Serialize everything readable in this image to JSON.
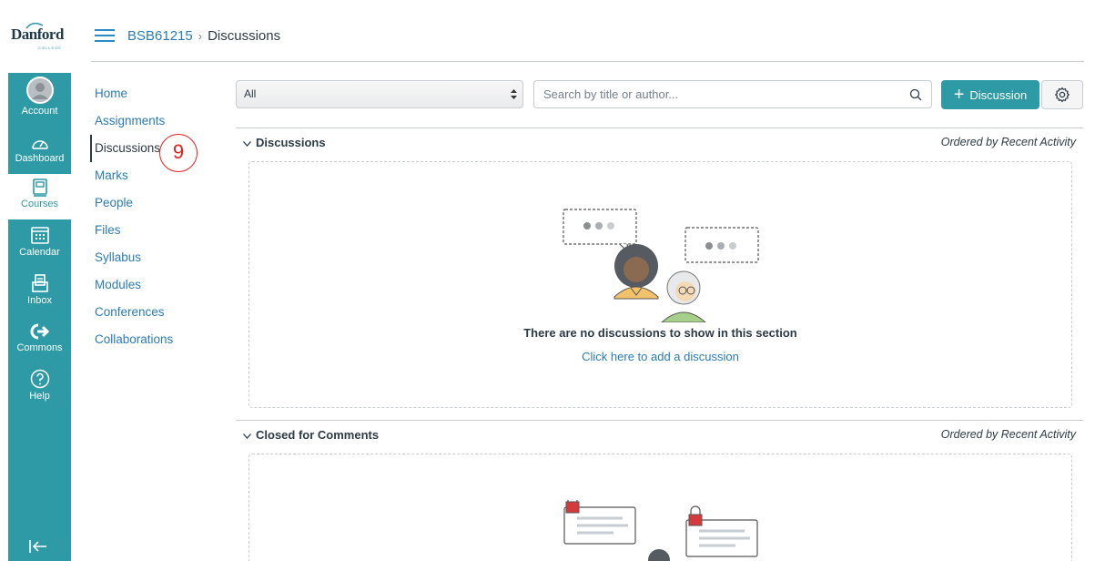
{
  "brand": {
    "name": "Danford",
    "sub": "COLLEGE"
  },
  "global_nav": [
    {
      "label": "Account",
      "icon": "avatar-icon"
    },
    {
      "label": "Dashboard",
      "icon": "dashboard-icon"
    },
    {
      "label": "Courses",
      "icon": "courses-icon"
    },
    {
      "label": "Calendar",
      "icon": "calendar-icon"
    },
    {
      "label": "Inbox",
      "icon": "inbox-icon"
    },
    {
      "label": "Commons",
      "icon": "commons-icon"
    },
    {
      "label": "Help",
      "icon": "help-icon"
    }
  ],
  "breadcrumb": {
    "course": "BSB61215",
    "separator": "›",
    "current": "Discussions"
  },
  "course_nav": [
    "Home",
    "Assignments",
    "Discussions",
    "Marks",
    "People",
    "Files",
    "Syllabus",
    "Modules",
    "Conferences",
    "Collaborations"
  ],
  "annotation": "9",
  "toolbar": {
    "filter_value": "All",
    "filter_arrows": "▲▼",
    "search_placeholder": "Search by title or author...",
    "add_label": "Discussion",
    "add_plus": "+"
  },
  "sections": {
    "discussions": {
      "title": "Discussions",
      "order": "Ordered by Recent Activity",
      "empty_title": "There are no discussions to show in this section",
      "empty_link": "Click here to add a discussion"
    },
    "closed": {
      "title": "Closed for Comments",
      "order": "Ordered by Recent Activity"
    }
  },
  "colors": {
    "accent": "#2d9aa5",
    "link": "#2b7bb5",
    "text": "#2d3b45",
    "annotation": "#e0221d"
  }
}
